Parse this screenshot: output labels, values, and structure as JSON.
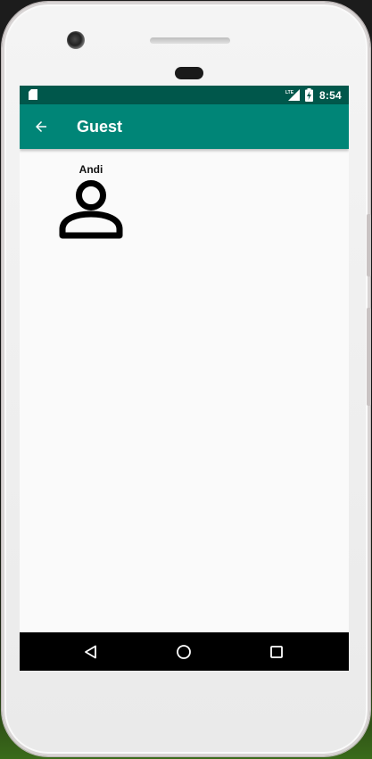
{
  "status_bar": {
    "time": "8:54",
    "network_label": "LTE",
    "icons": [
      "sd-card-icon",
      "lte-signal-icon",
      "battery-charging-icon"
    ]
  },
  "toolbar": {
    "title": "Guest",
    "back_icon": "arrow-back-icon"
  },
  "guests": [
    {
      "name": "Andi",
      "icon": "person-icon"
    }
  ],
  "nav_bar": {
    "icons": [
      "back-triangle-icon",
      "home-circle-icon",
      "recents-square-icon"
    ]
  },
  "colors": {
    "toolbar": "#008577",
    "status_bar": "#00574b",
    "background": "#fafafa",
    "nav_bar": "#000000"
  }
}
